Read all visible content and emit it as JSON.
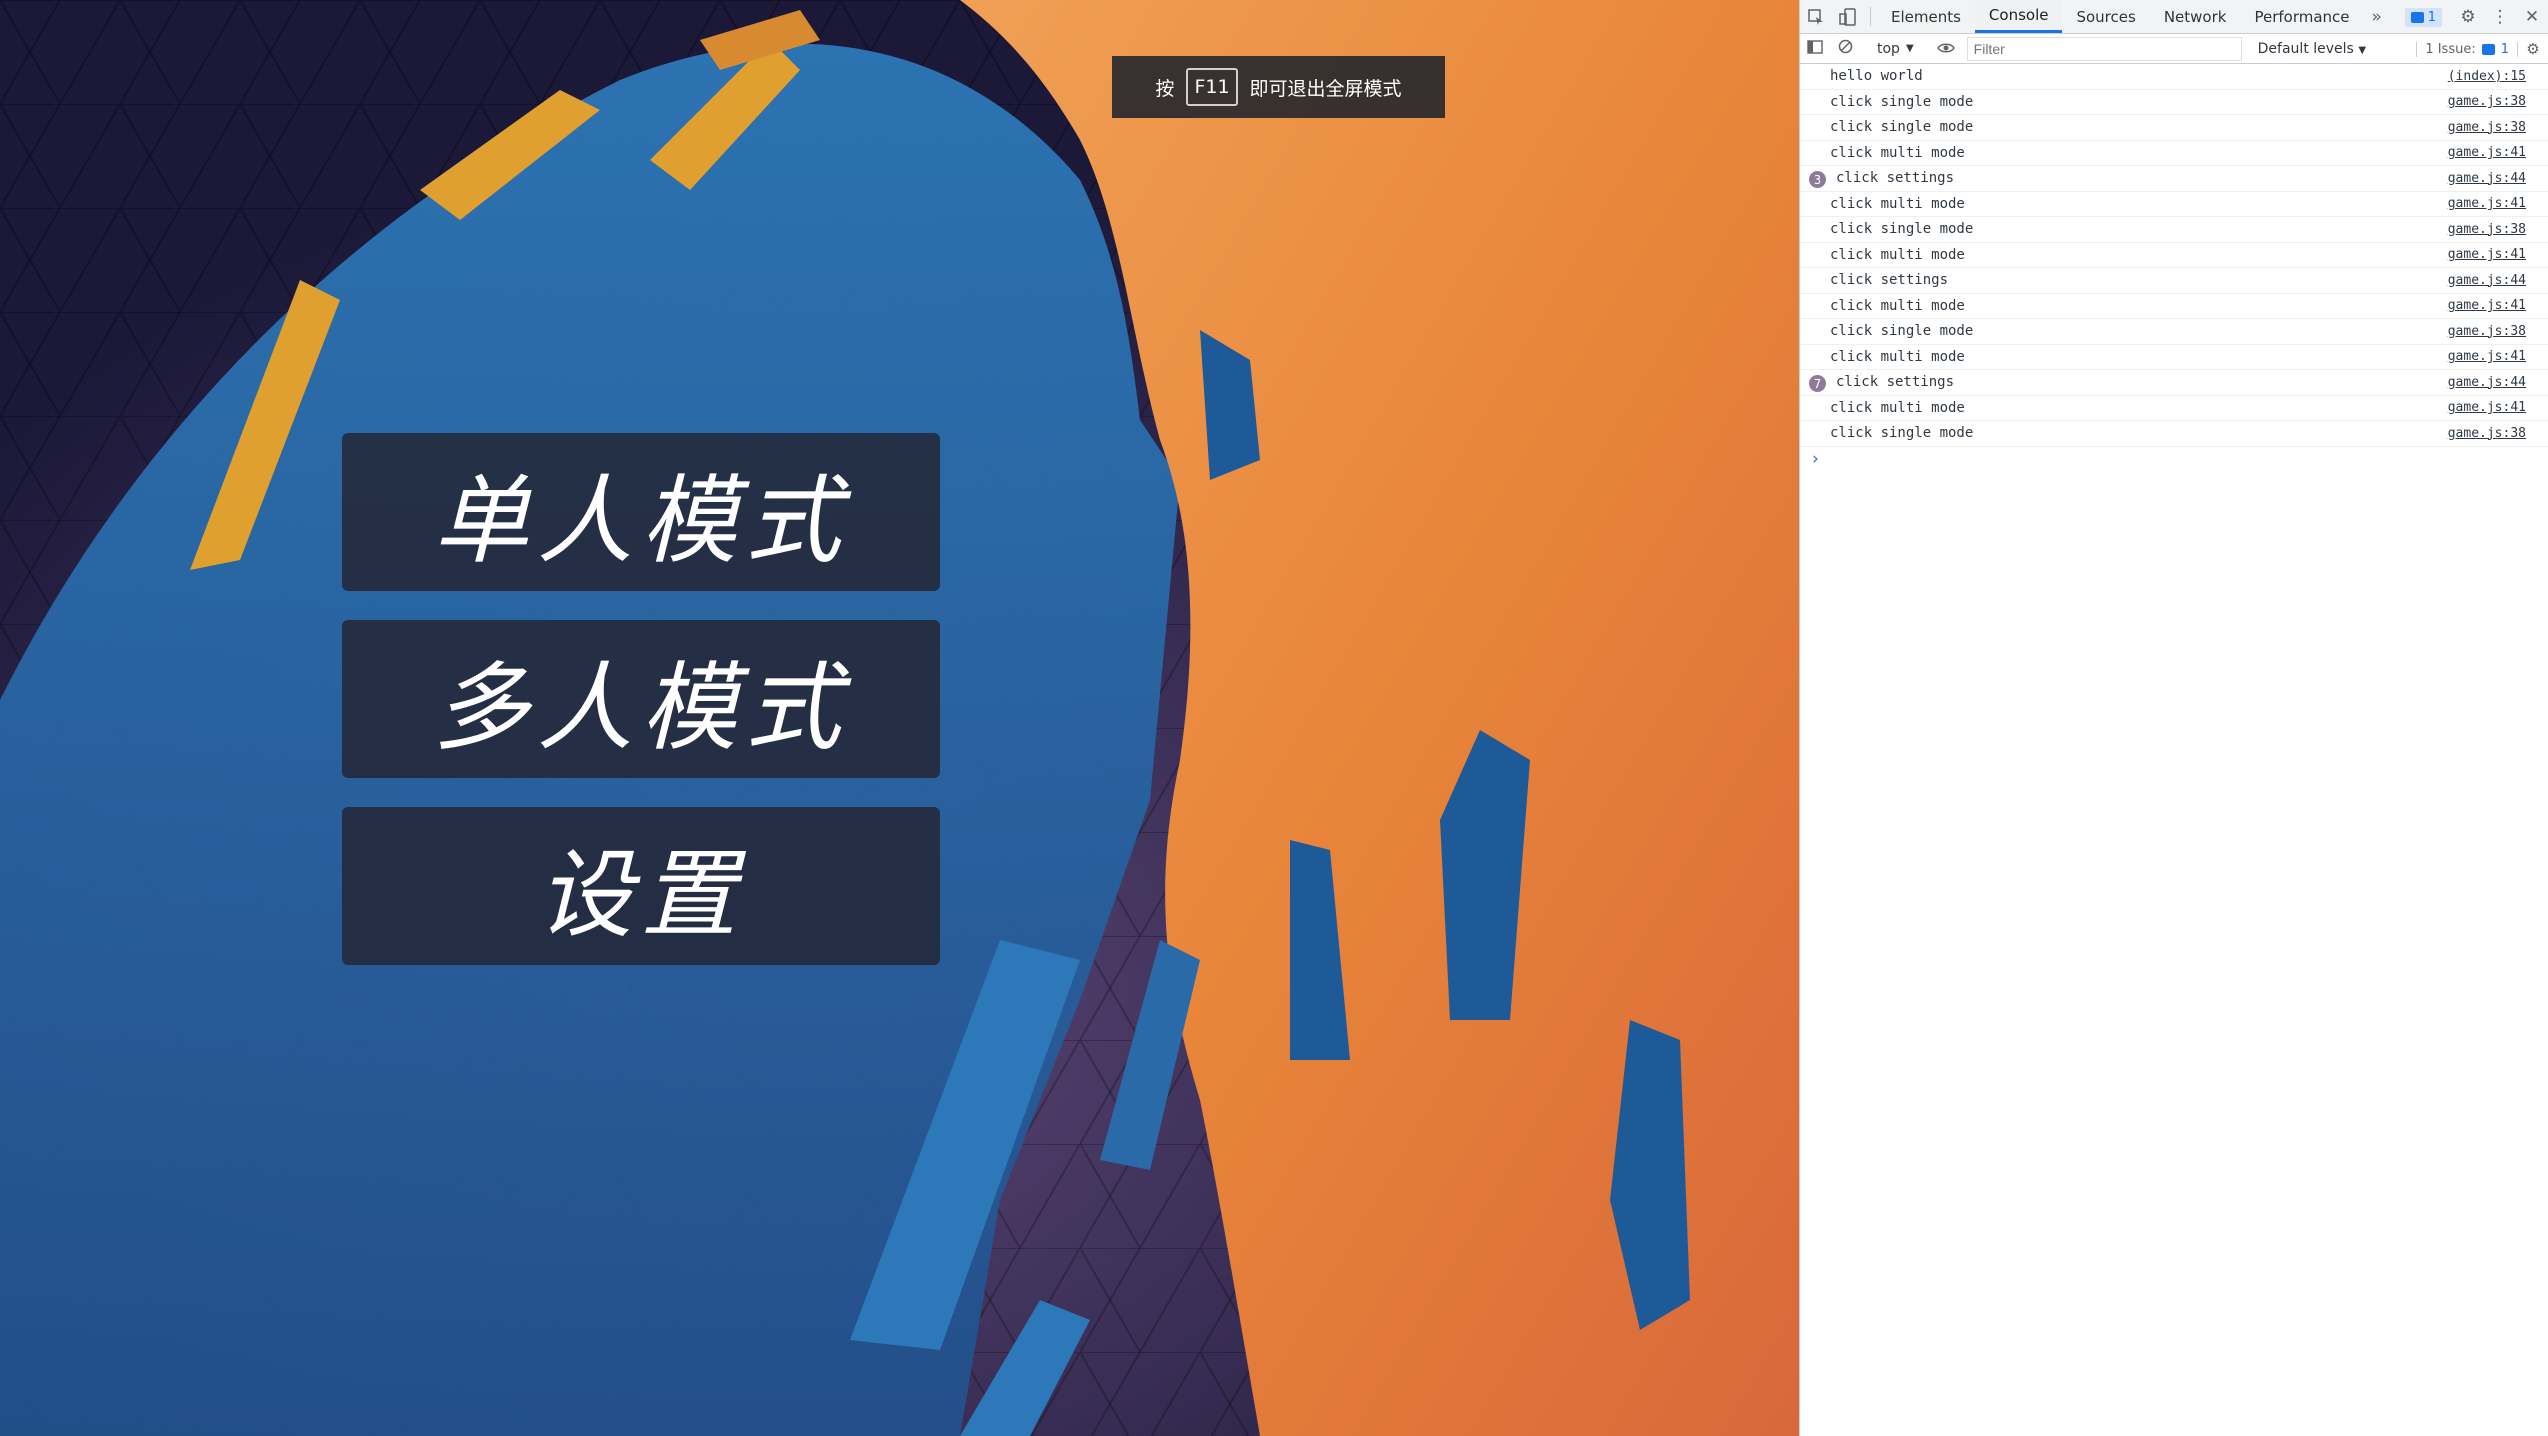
{
  "game": {
    "menu": {
      "single": "单人模式",
      "multi": "多人模式",
      "settings": "设置"
    },
    "fullscreen_toast": {
      "prefix": "按",
      "key": "F11",
      "suffix": "即可退出全屏模式"
    }
  },
  "devtools": {
    "tabs": [
      "Elements",
      "Console",
      "Sources",
      "Network",
      "Performance"
    ],
    "active_tab": "Console",
    "more_tabs_icon": "chevron-double-right-icon",
    "issue_badge_count": "1",
    "toolbar": {
      "context": "top",
      "filter_placeholder": "Filter",
      "levels": "Default levels",
      "issues_label": "1 Issue:",
      "issues_count": "1"
    },
    "console_rows": [
      {
        "msg": "hello world",
        "src": "(index):15",
        "count": ""
      },
      {
        "msg": "click single mode",
        "src": "game.js:38",
        "count": ""
      },
      {
        "msg": "click single mode",
        "src": "game.js:38",
        "count": ""
      },
      {
        "msg": "click multi mode",
        "src": "game.js:41",
        "count": ""
      },
      {
        "msg": "click settings",
        "src": "game.js:44",
        "count": "3"
      },
      {
        "msg": "click multi mode",
        "src": "game.js:41",
        "count": ""
      },
      {
        "msg": "click single mode",
        "src": "game.js:38",
        "count": ""
      },
      {
        "msg": "click multi mode",
        "src": "game.js:41",
        "count": ""
      },
      {
        "msg": "click settings",
        "src": "game.js:44",
        "count": ""
      },
      {
        "msg": "click multi mode",
        "src": "game.js:41",
        "count": ""
      },
      {
        "msg": "click single mode",
        "src": "game.js:38",
        "count": ""
      },
      {
        "msg": "click multi mode",
        "src": "game.js:41",
        "count": ""
      },
      {
        "msg": "click settings",
        "src": "game.js:44",
        "count": "7"
      },
      {
        "msg": "click multi mode",
        "src": "game.js:41",
        "count": ""
      },
      {
        "msg": "click single mode",
        "src": "game.js:38",
        "count": ""
      }
    ],
    "prompt": "›"
  },
  "colors": {
    "orange": "#e8853a",
    "blue": "#2a6aa8",
    "gold": "#e0a030",
    "accent": "#1a73e8"
  }
}
